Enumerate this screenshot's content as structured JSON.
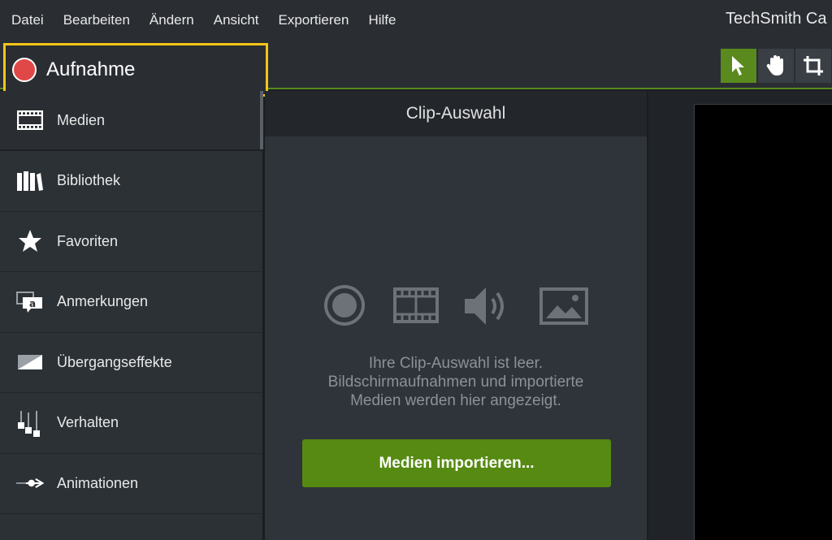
{
  "menu": {
    "items": [
      "Datei",
      "Bearbeiten",
      "Ändern",
      "Ansicht",
      "Exportieren",
      "Hilfe"
    ],
    "app_title": "TechSmith Ca"
  },
  "toolbar": {
    "record_label": "Aufnahme",
    "tools": [
      "select-arrow-icon",
      "pan-hand-icon",
      "crop-icon"
    ],
    "active_tool": "select-arrow-icon"
  },
  "sidebar": {
    "items": [
      {
        "label": "Medien",
        "icon": "filmstrip-icon"
      },
      {
        "label": "Bibliothek",
        "icon": "library-books-icon"
      },
      {
        "label": "Favoriten",
        "icon": "star-icon"
      },
      {
        "label": "Anmerkungen",
        "icon": "callout-icon"
      },
      {
        "label": "Übergangseffekte",
        "icon": "transition-icon"
      },
      {
        "label": "Verhalten",
        "icon": "behavior-icon"
      },
      {
        "label": "Animationen",
        "icon": "animation-arrow-icon"
      }
    ],
    "selected": "Medien"
  },
  "clip_bin": {
    "title": "Clip-Auswahl",
    "empty_line1": "Ihre Clip-Auswahl ist leer.",
    "empty_line2": "Bildschirmaufnahmen und importierte",
    "empty_line3": "Medien werden hier angezeigt.",
    "import_button": "Medien importieren...",
    "placeholder_icons": [
      "record-circle-icon",
      "filmstrip-icon",
      "speaker-icon",
      "image-icon"
    ]
  },
  "colors": {
    "accent_green": "#568a12",
    "record_red": "#e04848",
    "highlight_yellow": "#f5c518"
  }
}
